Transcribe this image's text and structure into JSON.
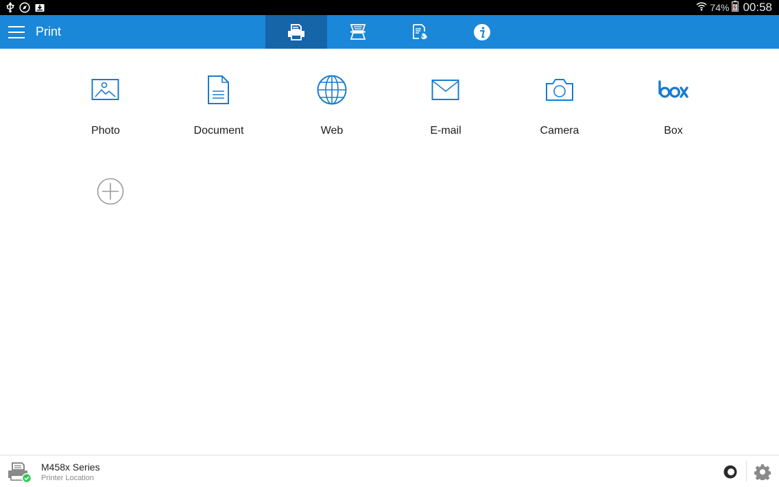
{
  "status_bar": {
    "battery_percent": "74%",
    "time": "00:58",
    "icons": [
      "usb-icon",
      "compass-icon",
      "download-icon",
      "wifi-icon",
      "battery-icon"
    ]
  },
  "app_bar": {
    "title": "Print",
    "tabs": [
      {
        "name": "print",
        "icon": "printer-icon",
        "active": true
      },
      {
        "name": "scan",
        "icon": "scanner-icon",
        "active": false
      },
      {
        "name": "copy-fax",
        "icon": "fax-icon",
        "active": false
      },
      {
        "name": "info",
        "icon": "info-icon",
        "active": false
      }
    ]
  },
  "sources": [
    {
      "label": "Photo",
      "icon": "photo-icon"
    },
    {
      "label": "Document",
      "icon": "document-icon"
    },
    {
      "label": "Web",
      "icon": "globe-icon"
    },
    {
      "label": "E-mail",
      "icon": "envelope-icon"
    },
    {
      "label": "Camera",
      "icon": "camera-icon"
    },
    {
      "label": "Box",
      "icon": "box-logo-icon"
    }
  ],
  "add_source": {
    "icon": "plus-circle-icon"
  },
  "bottom_bar": {
    "printer_name": "M458x Series",
    "printer_location": "Printer Location",
    "printer_status": "connected"
  },
  "colors": {
    "accent": "#1a87d9",
    "tab_active": "#1565a8",
    "icon_blue": "#1a7bd0",
    "status_ok": "#34c759"
  }
}
